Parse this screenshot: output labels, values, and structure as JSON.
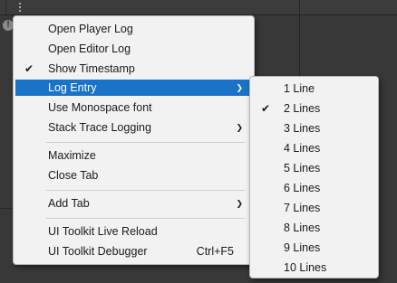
{
  "main_menu": {
    "items": [
      {
        "label": "Open Player Log",
        "checked": false,
        "submenu": false,
        "shortcut": ""
      },
      {
        "label": "Open Editor Log",
        "checked": false,
        "submenu": false,
        "shortcut": ""
      },
      {
        "label": "Show Timestamp",
        "checked": true,
        "submenu": false,
        "shortcut": ""
      },
      {
        "label": "Log Entry",
        "checked": false,
        "submenu": true,
        "shortcut": "",
        "highlighted": true
      },
      {
        "label": "Use Monospace font",
        "checked": false,
        "submenu": false,
        "shortcut": ""
      },
      {
        "label": "Stack Trace Logging",
        "checked": false,
        "submenu": true,
        "shortcut": ""
      },
      {
        "label": "Maximize",
        "checked": false,
        "submenu": false,
        "shortcut": ""
      },
      {
        "label": "Close Tab",
        "checked": false,
        "submenu": false,
        "shortcut": ""
      },
      {
        "label": "Add Tab",
        "checked": false,
        "submenu": true,
        "shortcut": ""
      },
      {
        "label": "UI Toolkit Live Reload",
        "checked": false,
        "submenu": false,
        "shortcut": ""
      },
      {
        "label": "UI Toolkit Debugger",
        "checked": false,
        "submenu": false,
        "shortcut": "Ctrl+F5"
      }
    ]
  },
  "log_entry_submenu": {
    "items": [
      {
        "label": "1 Line",
        "checked": false
      },
      {
        "label": "2 Lines",
        "checked": true
      },
      {
        "label": "3 Lines",
        "checked": false
      },
      {
        "label": "4 Lines",
        "checked": false
      },
      {
        "label": "5 Lines",
        "checked": false
      },
      {
        "label": "6 Lines",
        "checked": false
      },
      {
        "label": "7 Lines",
        "checked": false
      },
      {
        "label": "8 Lines",
        "checked": false
      },
      {
        "label": "9 Lines",
        "checked": false
      },
      {
        "label": "10 Lines",
        "checked": false
      }
    ]
  },
  "symbols": {
    "check": "✔",
    "arrow": "❯",
    "info": "!"
  },
  "colors": {
    "highlight": "#1a73c8",
    "menu_bg": "#f2f2f2",
    "editor_bg": "#383838"
  }
}
